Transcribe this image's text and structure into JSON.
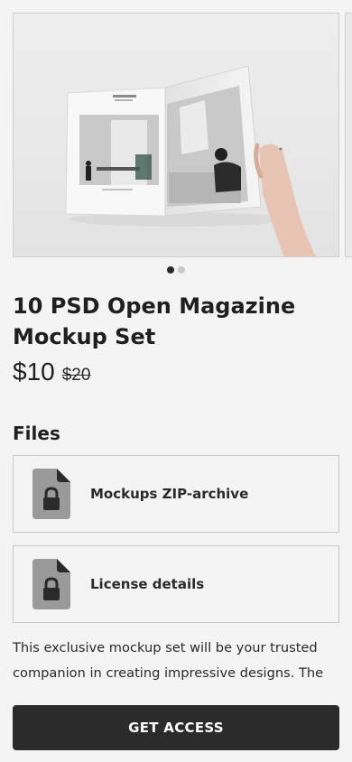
{
  "product": {
    "title": "10 PSD Open Magazine Mockup Set",
    "price": "$10",
    "old_price": "$20"
  },
  "carousel": {
    "slide_count": 2,
    "active_index": 0
  },
  "files": {
    "heading": "Files",
    "items": [
      {
        "label": "Mockups ZIP-archive",
        "icon": "locked-file-icon"
      },
      {
        "label": "License details",
        "icon": "locked-file-icon"
      }
    ]
  },
  "description": "This exclusive mockup set will be your trusted companion in creating impressive designs. The",
  "cta": {
    "label": "GET ACCESS"
  },
  "colors": {
    "background": "#f4f4f4",
    "cta_background": "#2c2b2b",
    "icon_gray": "#9a9a9a"
  }
}
